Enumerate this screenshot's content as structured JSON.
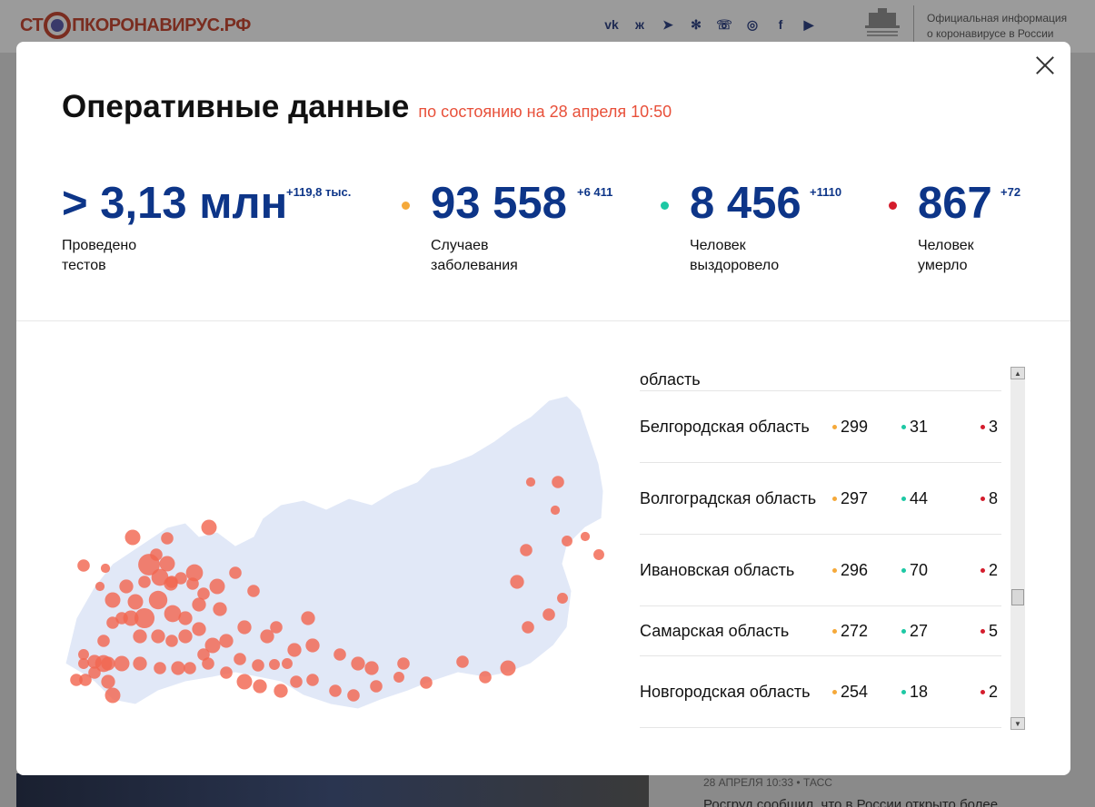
{
  "background": {
    "logo_text_left": "СТ",
    "logo_text_right": "ПКОРОНАВИРУС.РФ",
    "social_icons": [
      "vk-icon",
      "ok-icon",
      "telegram-icon",
      "yandex-zen-icon",
      "viber-icon",
      "instagram-icon",
      "facebook-icon",
      "youtube-icon"
    ],
    "social_glyphs": [
      "vk",
      "ж",
      "➤",
      "✻",
      "☏",
      "◎",
      "f",
      "▶"
    ],
    "gov_info_line1": "Официальная информация",
    "gov_info_line2": "о коронавирусе в России",
    "news_meta": "28 АПРЕЛЯ 10:33 • ТАСС",
    "news_title": "Росгруд сообщил, что в России открыто более"
  },
  "modal": {
    "title": "Оперативные данные",
    "as_of": "по состоянию на 28 апреля 10:50",
    "stats": [
      {
        "value": "> 3,13 млн",
        "delta": "+119,8 тыс.",
        "label": "Проведено тестов",
        "dot_color": ""
      },
      {
        "value": "93 558",
        "delta": "+6 411",
        "label": "Случаев заболевания",
        "dot_color": "#f5a93a"
      },
      {
        "value": "8 456",
        "delta": "+1110",
        "label": "Человек выздоровело",
        "dot_color": "#1dc8a4"
      },
      {
        "value": "867",
        "delta": "+72",
        "label": "Человек умерло",
        "dot_color": "#d41c2c"
      }
    ],
    "colors": {
      "accent": "#e8503a",
      "numbers": "#0d3588",
      "cases": "#f5a93a",
      "recovered": "#1dc8a4",
      "deaths": "#d41c2c",
      "map_fill": "#e1e8f7",
      "map_bubble": "#f26650"
    },
    "table": {
      "partial_row": "область",
      "rows": [
        {
          "region": "Белгородская область",
          "cases": "299",
          "recovered": "31",
          "deaths": "3"
        },
        {
          "region": "Волгоградская область",
          "cases": "297",
          "recovered": "44",
          "deaths": "8"
        },
        {
          "region": "Ивановская область",
          "cases": "296",
          "recovered": "70",
          "deaths": "2"
        },
        {
          "region": "Самарская область",
          "cases": "272",
          "recovered": "27",
          "deaths": "5"
        },
        {
          "region": "Новгородская область",
          "cases": "254",
          "recovered": "18",
          "deaths": "2"
        }
      ]
    }
  }
}
